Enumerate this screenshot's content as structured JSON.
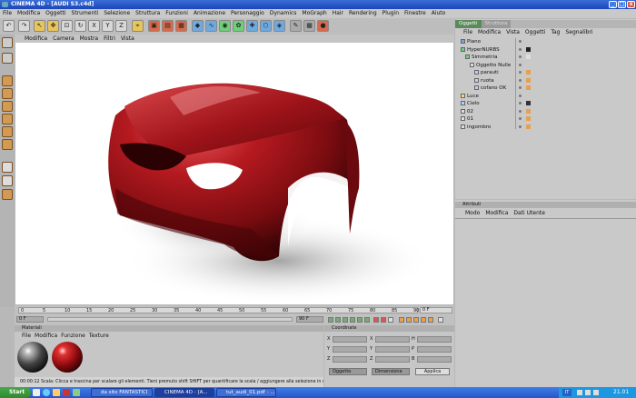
{
  "window": {
    "title": "CINEMA 4D - [AUDI S3.c4d]"
  },
  "menubar": [
    "File",
    "Modifica",
    "Oggetti",
    "Strumenti",
    "Selezione",
    "Struttura",
    "Funzioni",
    "Animazione",
    "Personaggio",
    "Dynamics",
    "MoGraph",
    "Hair",
    "Rendering",
    "Plugin",
    "Finestre",
    "Aiuto"
  ],
  "toolbar_letters": [
    "X",
    "Y",
    "Z"
  ],
  "viewport": {
    "menu": [
      "Modifica",
      "Camera",
      "Mostra",
      "Filtri",
      "Vista"
    ]
  },
  "timeline": {
    "ticks": [
      "0",
      "5",
      "10",
      "15",
      "20",
      "25",
      "30",
      "35",
      "40",
      "45",
      "50",
      "55",
      "60",
      "65",
      "70",
      "75",
      "80",
      "85",
      "90"
    ],
    "end_label": "0 F",
    "start_field": "0 F",
    "end_field": "90 F"
  },
  "materials": {
    "title": "Materiali",
    "menu": [
      "File",
      "Modifica",
      "Funzione",
      "Texture"
    ],
    "status": "00:00:12  Scala: Clicca e trascina per scalare gli elementi. Tieni premuto shift SHIFT per quantificare la scala / aggiungere alla selezione in modo punto, CTRL per rimuovere."
  },
  "coordinates": {
    "title": "Coordinate",
    "axes": [
      {
        "pos": "X",
        "rot": "X",
        "size": "H"
      },
      {
        "pos": "Y",
        "rot": "Y",
        "size": "P"
      },
      {
        "pos": "Z",
        "rot": "Z",
        "size": "B"
      }
    ],
    "mode": "Oggetto",
    "size_mode": "Dimensione",
    "apply": "Applica"
  },
  "objects": {
    "tabs": [
      "Oggetti",
      "Struttura"
    ],
    "menu": [
      "File",
      "Modifica",
      "Vista",
      "Oggetti",
      "Tag",
      "Segnalibri"
    ],
    "items": [
      {
        "name": "Piano",
        "indent": 0
      },
      {
        "name": "HyperNURBS",
        "indent": 0
      },
      {
        "name": "Simmetria",
        "indent": 1
      },
      {
        "name": "Oggetto Nulle",
        "indent": 2
      },
      {
        "name": "parauti",
        "indent": 3
      },
      {
        "name": "ruota",
        "indent": 3
      },
      {
        "name": "cofano OK",
        "indent": 3
      },
      {
        "name": "Luce",
        "indent": 0
      },
      {
        "name": "Cielo",
        "indent": 0
      },
      {
        "name": "02",
        "indent": 0
      },
      {
        "name": "01",
        "indent": 0
      },
      {
        "name": "ingombro",
        "indent": 0
      }
    ]
  },
  "attributes": {
    "title": "Attributi",
    "menu": [
      "Modo",
      "Modifica",
      "Dati Utente"
    ]
  },
  "taskbar": {
    "start": "Start",
    "items": [
      "da sito FANTASTICI",
      "CINEMA 4D - [A...",
      "tut_audi_01.pdf - ..."
    ],
    "lang": "IT",
    "clock": "21.01"
  },
  "colors": {
    "accent": "#1b46b8",
    "car": "#8a0f14"
  }
}
